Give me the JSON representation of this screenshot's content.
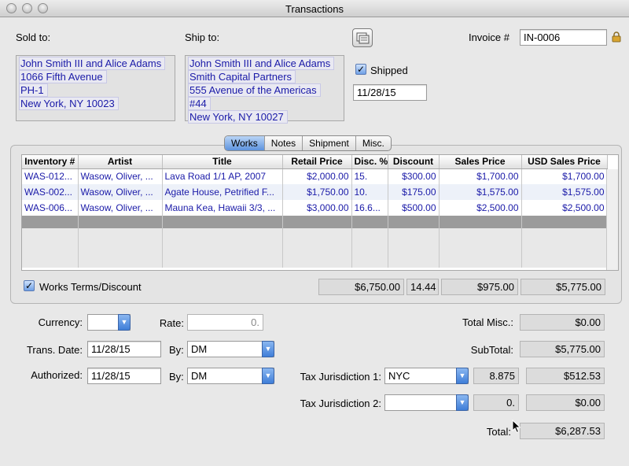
{
  "window": {
    "title": "Transactions"
  },
  "sold_to": {
    "label": "Sold to:",
    "lines": [
      "John Smith III and Alice Adams",
      "1066 Fifth Avenue",
      "PH-1",
      "New York, NY 10023"
    ]
  },
  "ship_to": {
    "label": "Ship to:",
    "lines": [
      "John Smith III and Alice Adams",
      "Smith Capital Partners",
      "555 Avenue of the Americas",
      "#44",
      "New York, NY 10027"
    ]
  },
  "invoice": {
    "label": "Invoice #",
    "value": "IN-0006"
  },
  "shipped": {
    "label": "Shipped",
    "checked": true,
    "date": "11/28/15"
  },
  "tabs": [
    "Works",
    "Notes",
    "Shipment",
    "Misc."
  ],
  "table": {
    "headers": [
      "Inventory #",
      "Artist",
      "Title",
      "Retail Price",
      "Disc. %",
      "Discount",
      "Sales Price",
      "USD Sales Price"
    ],
    "rows": [
      [
        "WAS-012...",
        "Wasow, Oliver, ...",
        "Lava Road 1/1 AP, 2007",
        "$2,000.00",
        "15.",
        "$300.00",
        "$1,700.00",
        "$1,700.00"
      ],
      [
        "WAS-002...",
        "Wasow, Oliver, ...",
        "Agate House, Petrified F...",
        "$1,750.00",
        "10.",
        "$175.00",
        "$1,575.00",
        "$1,575.00"
      ],
      [
        "WAS-006...",
        "Wasow, Oliver, ...",
        "Mauna Kea, Hawaii 3/3, ...",
        "$3,000.00",
        "16.6...",
        "$500.00",
        "$2,500.00",
        "$2,500.00"
      ]
    ]
  },
  "works_terms": {
    "label": "Works Terms/Discount",
    "checked": true
  },
  "totals_row": {
    "retail": "$6,750.00",
    "disc_pct": "14.44",
    "discount": "$975.00",
    "sales": "$5,775.00"
  },
  "currency": {
    "label": "Currency:",
    "value": ""
  },
  "rate": {
    "label": "Rate:",
    "value": "0."
  },
  "trans_date": {
    "label": "Trans. Date:",
    "value": "11/28/15",
    "by_label": "By:",
    "by_value": "DM"
  },
  "authorized": {
    "label": "Authorized:",
    "value": "11/28/15",
    "by_label": "By:",
    "by_value": "DM"
  },
  "total_misc": {
    "label": "Total Misc.:",
    "value": "$0.00"
  },
  "subtotal": {
    "label": "SubTotal:",
    "value": "$5,775.00"
  },
  "tax1": {
    "label": "Tax Jurisdiction 1:",
    "jurisdiction": "NYC",
    "rate": "8.875",
    "amount": "$512.53"
  },
  "tax2": {
    "label": "Tax Jurisdiction 2:",
    "jurisdiction": "",
    "rate": "0.",
    "amount": "$0.00"
  },
  "total": {
    "label": "Total:",
    "value": "$6,287.53"
  },
  "colors": {
    "link_text": "#1a1aa8",
    "accent": "#5d93de"
  },
  "icons": {
    "copy_address": "copy-address-icon",
    "lock": "lock-icon"
  }
}
